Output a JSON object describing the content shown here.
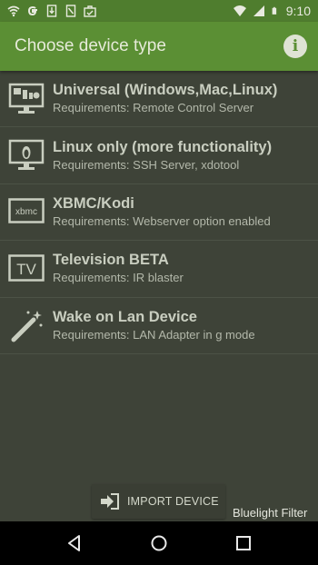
{
  "status_bar": {
    "time": "9:10",
    "left_icons": [
      "wifi-icon",
      "google-icon",
      "download-icon",
      "notes-icon",
      "briefcase-icon"
    ],
    "right_icons": [
      "wifi-signal-icon",
      "cell-signal-icon",
      "battery-icon"
    ]
  },
  "app_bar": {
    "title": "Choose device type",
    "info_icon": "info-icon",
    "color": "#5b8f34"
  },
  "devices": [
    {
      "title": "Universal (Windows,Mac,Linux)",
      "subtitle": "Requirements: Remote Control Server",
      "icon": "monitor-os-icon"
    },
    {
      "title": "Linux only (more functionality)",
      "subtitle": "Requirements: SSH Server, xdotool",
      "icon": "monitor-linux-icon"
    },
    {
      "title": "XBMC/Kodi",
      "subtitle": "Requirements: Webserver option enabled",
      "icon": "xbmc-icon",
      "icon_text": "xbmc"
    },
    {
      "title": "Television BETA",
      "subtitle": "Requirements: IR blaster",
      "icon": "tv-icon",
      "icon_text": "TV"
    },
    {
      "title": "Wake on Lan Device",
      "subtitle": "Requirements: LAN Adapter in g mode",
      "icon": "magic-wand-icon"
    }
  ],
  "import_button": {
    "label": "IMPORT DEVICE",
    "icon": "import-icon"
  },
  "overlay_label": "Bluelight Filter",
  "nav_bar": {
    "icons": [
      "back-icon",
      "home-icon",
      "recents-icon"
    ]
  }
}
